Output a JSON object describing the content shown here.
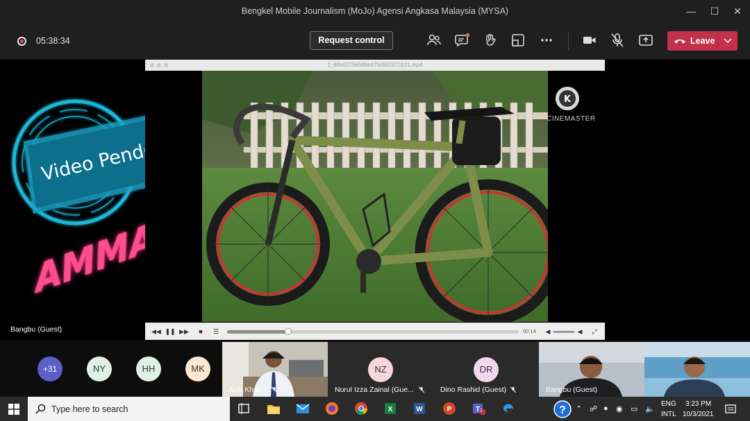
{
  "window": {
    "title": "Bengkel Mobile Journalism (MoJo) Agensi Angkasa Malaysia (MYSA)"
  },
  "toolbar": {
    "timer": "05:38:34",
    "request_control": "Request control",
    "leave": "Leave"
  },
  "stage": {
    "banner_text": "Video Pendek",
    "name_text": "AMMAR",
    "speaker": "Bangbu (Guest)"
  },
  "player": {
    "filename": "1_68e62756586b4750582071121.mp4",
    "watermark": "CINEMASTER",
    "time": "00:14",
    "progress": 0.21
  },
  "participants": {
    "overflow": "+31",
    "avatars": [
      {
        "initials": "NY",
        "color": "#dff0e6"
      },
      {
        "initials": "HH",
        "color": "#dff0e6"
      },
      {
        "initials": "MK",
        "color": "#fbe7d2"
      }
    ],
    "tiles": [
      {
        "name": "Azlil Khan"
      },
      {
        "name": "Nurul Izza Zainal (Gue...",
        "initials": "NZ",
        "color": "#f6d5dc"
      },
      {
        "name": "Dino Rashid (Guest)",
        "initials": "DR",
        "color": "#f2d8ef"
      },
      {
        "name": "Bangbu (Guest)"
      },
      {
        "name": ""
      }
    ]
  },
  "taskbar": {
    "search_placeholder": "Type here to search",
    "lang1": "ENG",
    "lang2": "INTL",
    "time": "3:23 PM",
    "date": "10/3/2021",
    "teams_badge": "1"
  }
}
